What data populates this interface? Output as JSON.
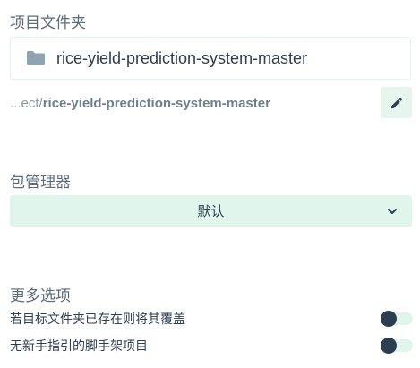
{
  "project_folder": {
    "label": "项目文件夹",
    "folder_icon": "folder-icon",
    "folder_name": "rice-yield-prediction-system-master",
    "path_prefix": "...ect/",
    "path_name": "rice-yield-prediction-system-master",
    "edit_icon": "pencil-icon"
  },
  "package_manager": {
    "label": "包管理器",
    "selected": "默认",
    "chevron_icon": "chevron-down-icon"
  },
  "more_options": {
    "label": "更多选项",
    "options": [
      {
        "label": "若目标文件夹已存在则将其覆盖",
        "enabled": false
      },
      {
        "label": "无新手指引的脚手架项目",
        "enabled": false
      }
    ]
  },
  "colors": {
    "accent_light": "#e0f6ec",
    "text_dark": "#2c3e50",
    "text_muted": "#8a98a5",
    "folder_icon": "#8ea4b2"
  }
}
